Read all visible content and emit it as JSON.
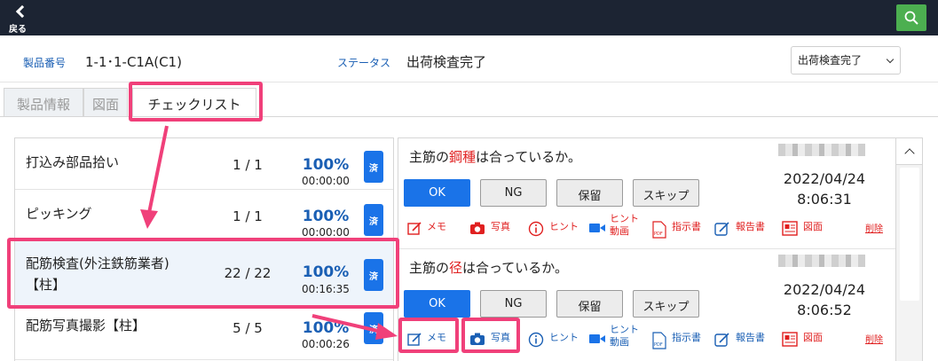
{
  "topbar": {
    "back_label": "戻る",
    "back_icon": "chevron-left-icon",
    "search_icon": "search-icon",
    "search_color": "#4caf50"
  },
  "header": {
    "product_no_label": "製品番号",
    "product_no_value": "1-1･1-C1A(C1)",
    "status_label": "ステータス",
    "status_value": "出荷検査完了",
    "status_select": "出荷検査完了"
  },
  "tabs": [
    {
      "label": "製品情報"
    },
    {
      "label": "図面"
    },
    {
      "label": "チェックリスト",
      "active": true
    }
  ],
  "checklist": [
    {
      "name": [
        "打込み部品拾い"
      ],
      "count": "1 / 1",
      "percent": "100%",
      "time": "00:00:00",
      "done": "済"
    },
    {
      "name": [
        "ピッキング"
      ],
      "count": "1 / 1",
      "percent": "100%",
      "time": "00:00:00",
      "done": "済"
    },
    {
      "name": [
        "配筋検査(外注鉄筋業者)",
        "【柱】"
      ],
      "count": "22 / 22",
      "percent": "100%",
      "time": "00:16:35",
      "done": "済",
      "selected": true
    },
    {
      "name": [
        "配筋写真撮影【柱】"
      ],
      "count": "5 / 5",
      "percent": "100%",
      "time": "00:00:26",
      "done": "済"
    }
  ],
  "items": [
    {
      "q_before": "主筋の",
      "q_highlight": "鋼種",
      "q_after": "は合っているか。",
      "date": "2022/04/24",
      "time": "8:06:31"
    },
    {
      "q_before": "主筋の",
      "q_highlight": "径",
      "q_after": "は合っているか。",
      "date": "2022/04/24",
      "time": "8:06:52"
    }
  ],
  "answers": {
    "ok": "OK",
    "ng": "NG",
    "hold": "保留",
    "skip": "スキップ"
  },
  "actions": {
    "memo": "メモ",
    "photo": "写真",
    "hint": "ヒント",
    "hint_video": "ヒント\n動画",
    "instructions": "指示書",
    "report": "報告書",
    "drawing": "図面",
    "delete": "削除"
  },
  "colors": {
    "accent_blue": "#1a73e8",
    "highlight_pink": "#f0407a",
    "topbar": "#1c2433",
    "alert_red": "#e02020"
  }
}
